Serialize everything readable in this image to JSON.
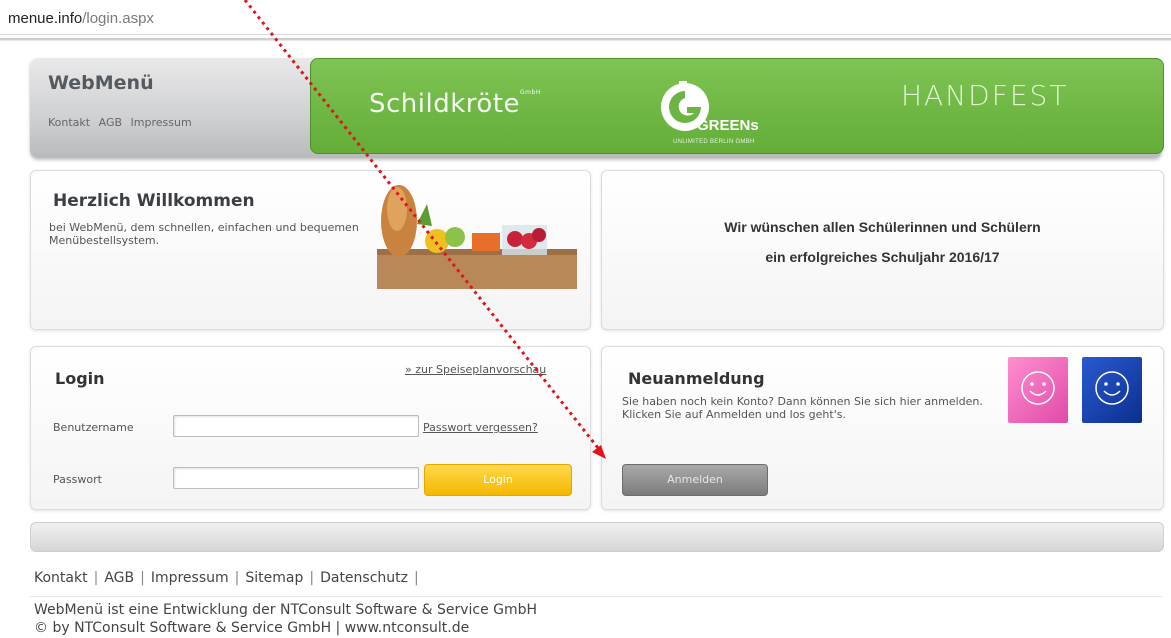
{
  "browser": {
    "url_domain": "menue.info",
    "url_path": "/login.aspx"
  },
  "header": {
    "brand": "WebMenü",
    "links": [
      "Kontakt",
      "AGB",
      "Impressum"
    ],
    "banner": {
      "schildkroete": "Schildkröte",
      "schildkroete_mark": "GmbH",
      "greens": "GREENs",
      "greens_sub": "UNLIMITED BERLIN GMBH",
      "handfest": "HANDFEST",
      "banner_color": "#6cb544"
    }
  },
  "welcome": {
    "title": "Herzlich Willkommen",
    "text": "bei WebMenü, dem schnellen, einfachen und bequemen Menübestellsystem."
  },
  "notice": {
    "line1": "Wir wünschen allen Schülerinnen und Schülern",
    "line2": "ein erfolgreiches Schuljahr 2016/17"
  },
  "login": {
    "title": "Login",
    "preview_link": "» zur Speiseplanvorschau",
    "username_label": "Benutzername",
    "password_label": "Passwort",
    "username_value": "",
    "password_value": "",
    "forgot_link": "Passwort vergessen?",
    "submit_label": "Login",
    "accent": "#f7c200"
  },
  "register": {
    "title": "Neuanmeldung",
    "text": "Sie haben noch kein Konto? Dann können Sie sich hier anmelden. Klicken Sie auf Anmelden und los geht's.",
    "button_label": "Anmelden",
    "icons": [
      "smiley-pink-icon",
      "smiley-blue-icon"
    ]
  },
  "footer": {
    "links": [
      "Kontakt",
      "AGB",
      "Impressum",
      "Sitemap",
      "Datenschutz"
    ],
    "line1": "WebMenü ist eine Entwicklung der NTConsult Software & Service GmbH",
    "line2": "© by NTConsult Software & Service GmbH | www.ntconsult.de"
  },
  "annotation": {
    "arrow_color": "#e0141b"
  }
}
